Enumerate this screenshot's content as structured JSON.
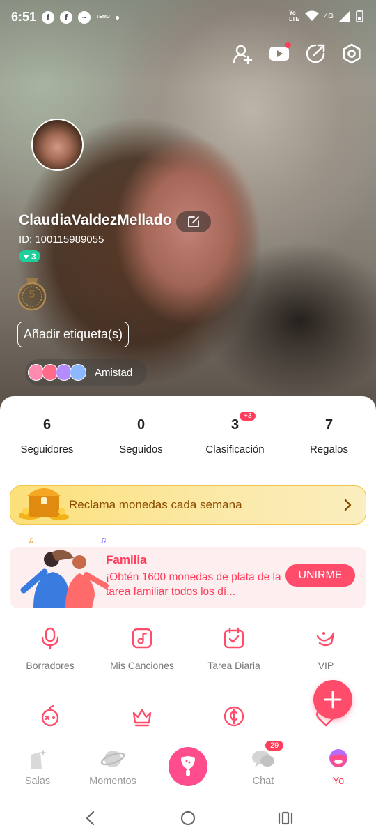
{
  "status_bar": {
    "time": "6:51",
    "left_icons": [
      "facebook-icon",
      "facebook-icon",
      "messenger-icon",
      "temu-icon",
      "dot-icon"
    ],
    "temu_label": "TEMU",
    "network_label_1": "Yo",
    "network_label_2": "LTE",
    "network_type": "4G"
  },
  "top_actions": [
    "add-friend-icon",
    "video-icon",
    "share-icon",
    "settings-icon"
  ],
  "profile": {
    "username": "ClaudiaValdezMellado",
    "user_id": "ID: 100115989055",
    "level": "3",
    "medal_level": "5",
    "add_tag_label": "Añadir etiqueta(s)",
    "friendship_label": "Amistad",
    "badge_colors": [
      "#ff8ab0",
      "#ff6a8a",
      "#b58cff",
      "#8cb8ff"
    ]
  },
  "stats": [
    {
      "value": "6",
      "label": "Seguidores",
      "badge": ""
    },
    {
      "value": "0",
      "label": "Seguidos",
      "badge": ""
    },
    {
      "value": "3",
      "label": "Clasificación",
      "badge": "+3"
    },
    {
      "value": "7",
      "label": "Regalos",
      "badge": ""
    }
  ],
  "coins_banner": {
    "text": "Reclama monedas cada semana"
  },
  "family": {
    "title": "Familia",
    "description": "¡Obtén 1600 monedas de plata de la tarea familiar todos los dí...",
    "join_label": "UNIRME"
  },
  "grid_row_1": [
    {
      "icon": "microphone-icon",
      "label": "Borradores"
    },
    {
      "icon": "music-note-icon",
      "label": "Mis Canciones"
    },
    {
      "icon": "calendar-check-icon",
      "label": "Tarea Diaria"
    },
    {
      "icon": "vip-icon",
      "label": "VIP"
    }
  ],
  "grid_row_2": [
    {
      "icon": "game-controller-icon",
      "label": ""
    },
    {
      "icon": "crown-icon",
      "label": ""
    },
    {
      "icon": "coin-icon",
      "label": ""
    },
    {
      "icon": "heart-icon",
      "label": ""
    }
  ],
  "tabs": [
    {
      "label": "Salas",
      "icon": "rooms-icon"
    },
    {
      "label": "Momentos",
      "icon": "planet-icon"
    },
    {
      "label": "",
      "icon": "microphone-icon"
    },
    {
      "label": "Chat",
      "icon": "chat-icon",
      "badge": "29"
    },
    {
      "label": "Yo",
      "icon": "profile-icon"
    }
  ],
  "colors": {
    "accent": "#ff4c6a",
    "level_green": "#1ecf9a",
    "coins_text": "#8a4b00"
  }
}
